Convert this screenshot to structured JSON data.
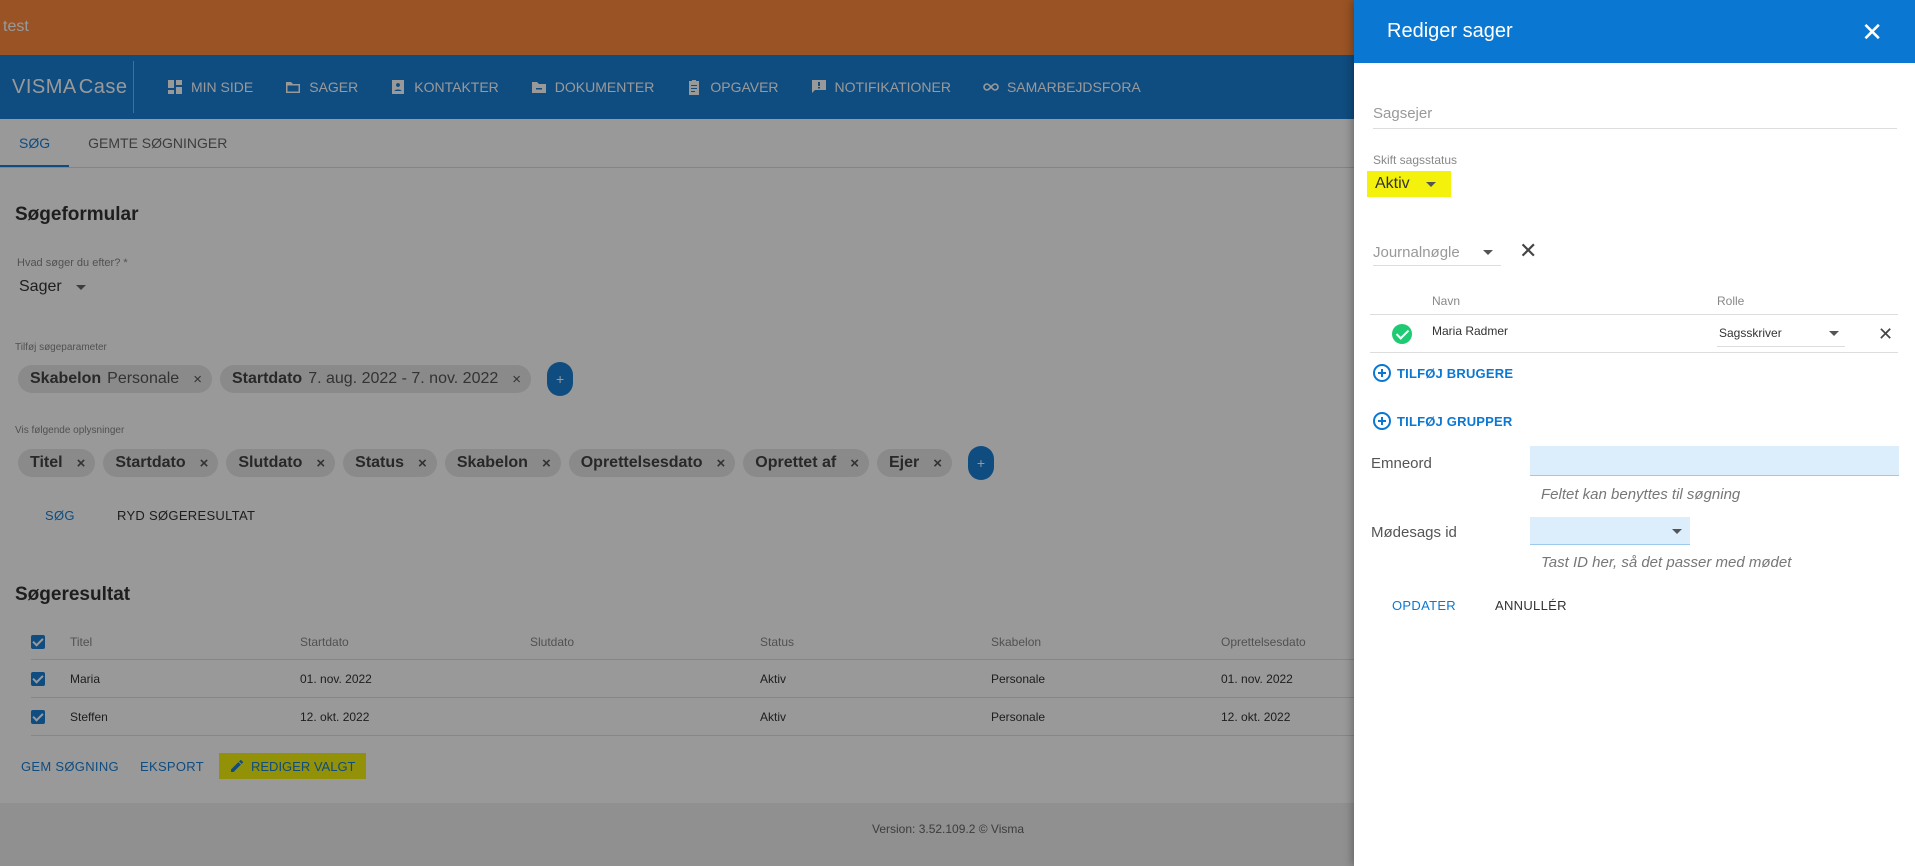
{
  "env_label": "test",
  "brand": {
    "part1": "VISMA",
    "part2": "Case"
  },
  "nav": [
    {
      "label": "MIN SIDE",
      "icon": "dashboard-icon"
    },
    {
      "label": "SAGER",
      "icon": "folder-icon"
    },
    {
      "label": "KONTAKTER",
      "icon": "contact-icon"
    },
    {
      "label": "DOKUMENTER",
      "icon": "document-folder-icon"
    },
    {
      "label": "OPGAVER",
      "icon": "clipboard-icon"
    },
    {
      "label": "NOTIFIKATIONER",
      "icon": "message-icon"
    },
    {
      "label": "SAMARBEJDSFORA",
      "icon": "infinity-icon"
    }
  ],
  "tabs": {
    "search": "SØG",
    "saved": "GEMTE SØGNINGER"
  },
  "search_form": {
    "title": "Søgeformular",
    "what_label": "Hvad søger du efter? *",
    "what_value": "Sager",
    "params_label": "Tilføj søgeparameter",
    "params": [
      {
        "key": "Skabelon",
        "value": "Personale"
      },
      {
        "key": "Startdato",
        "value": "7. aug. 2022 - 7. nov. 2022"
      }
    ],
    "show_label": "Vis følgende oplysninger",
    "columns": [
      "Titel",
      "Startdato",
      "Slutdato",
      "Status",
      "Skabelon",
      "Oprettelsesdato",
      "Oprettet af",
      "Ejer"
    ],
    "add_symbol": "+",
    "remove_symbol": "×",
    "search_btn": "SØG",
    "clear_btn": "RYD SØGERESULTAT"
  },
  "results": {
    "title": "Søgeresultat",
    "headers": [
      "Titel",
      "Startdato",
      "Slutdato",
      "Status",
      "Skabelon",
      "Oprettelsesdato"
    ],
    "rows": [
      {
        "title": "Maria",
        "start": "01. nov. 2022",
        "end": "",
        "status": "Aktiv",
        "template": "Personale",
        "created": "01. nov. 2022"
      },
      {
        "title": "Steffen",
        "start": "12. okt. 2022",
        "end": "",
        "status": "Aktiv",
        "template": "Personale",
        "created": "12. okt. 2022"
      }
    ],
    "save_btn": "GEM SØGNING",
    "export_btn": "EKSPORT",
    "edit_btn": "REDIGER VALGT"
  },
  "footer": {
    "version": "Version: 3.52.109.2  © Visma"
  },
  "dialog": {
    "title": "Rediger sager",
    "close_symbol": "✕",
    "owner_placeholder": "Sagsejer",
    "status_label": "Skift sagsstatus",
    "status_value": "Aktiv",
    "journal_placeholder": "Journalnøgle",
    "clear_symbol": "✕",
    "users": {
      "col_name": "Navn",
      "col_role": "Rolle",
      "rows": [
        {
          "name": "Maria Radmer",
          "role": "Sagsskriver"
        }
      ]
    },
    "add_users": "TILFØJ BRUGERE",
    "add_groups": "TILFØJ GRUPPER",
    "keywords_label": "Emneord",
    "keywords_value": "",
    "keywords_hint": "Feltet kan benyttes til søgning",
    "meeting_label": "Mødesags id",
    "meeting_value": "",
    "meeting_hint": "Tast ID her, så det passer med mødet",
    "update_btn": "OPDATER",
    "cancel_btn": "ANNULLÉR"
  },
  "colors": {
    "primary": "#1a7fd6",
    "highlight": "#f4f20c",
    "env": "#ff8a3d",
    "success": "#1ecb72"
  }
}
